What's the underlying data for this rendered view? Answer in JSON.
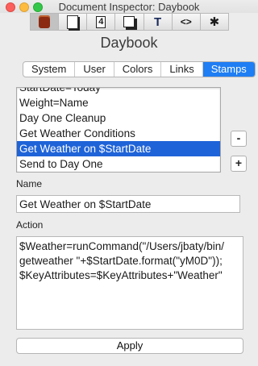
{
  "window": {
    "title": "Document Inspector: Daybook"
  },
  "toolbar": {
    "icons": [
      "document-icon",
      "page-icon",
      "page-number-icon",
      "shadow-frame-icon",
      "text-icon",
      "code-icon",
      "gear-icon"
    ],
    "labels": {
      "number": "4",
      "text": "T",
      "code": "<>",
      "gear": "✱"
    }
  },
  "document": {
    "name": "Daybook"
  },
  "tabs": [
    {
      "label": "System",
      "active": false
    },
    {
      "label": "User",
      "active": false
    },
    {
      "label": "Colors",
      "active": false
    },
    {
      "label": "Links",
      "active": false
    },
    {
      "label": "Stamps",
      "active": true
    }
  ],
  "stamps": {
    "items": [
      "StartDate=Today",
      "Weight=Name",
      "Day One Cleanup",
      "Get Weather Conditions",
      "Get Weather on $StartDate",
      "Send to Day One"
    ],
    "selected_index": 4,
    "remove_label": "-",
    "add_label": "+"
  },
  "form": {
    "name_label": "Name",
    "name_value": "Get Weather on $StartDate",
    "action_label": "Action",
    "action_value": "$Weather=runCommand(\"/Users/jbaty/bin/\ngetweather \"+$StartDate.format(\"yM0D\"));\n$KeyAttributes=$KeyAttributes+\"Weather\"",
    "apply_label": "Apply"
  },
  "colors": {
    "accent": "#1f7ef3",
    "selection": "#1f63d8"
  }
}
